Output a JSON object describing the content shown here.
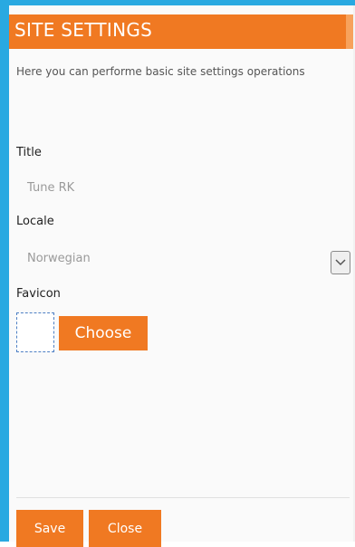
{
  "header": {
    "title": "SITE SETTINGS"
  },
  "description": "Here you can performe basic site settings operations",
  "fields": {
    "title": {
      "label": "Title",
      "value": "Tune RK"
    },
    "locale": {
      "label": "Locale",
      "value": "Norwegian"
    },
    "favicon": {
      "label": "Favicon",
      "choose_label": "Choose"
    }
  },
  "footer": {
    "save_label": "Save",
    "close_label": "Close"
  },
  "colors": {
    "accent": "#f07922",
    "frame": "#29a9e1"
  },
  "icons": {
    "select": "chevron-down-icon"
  }
}
